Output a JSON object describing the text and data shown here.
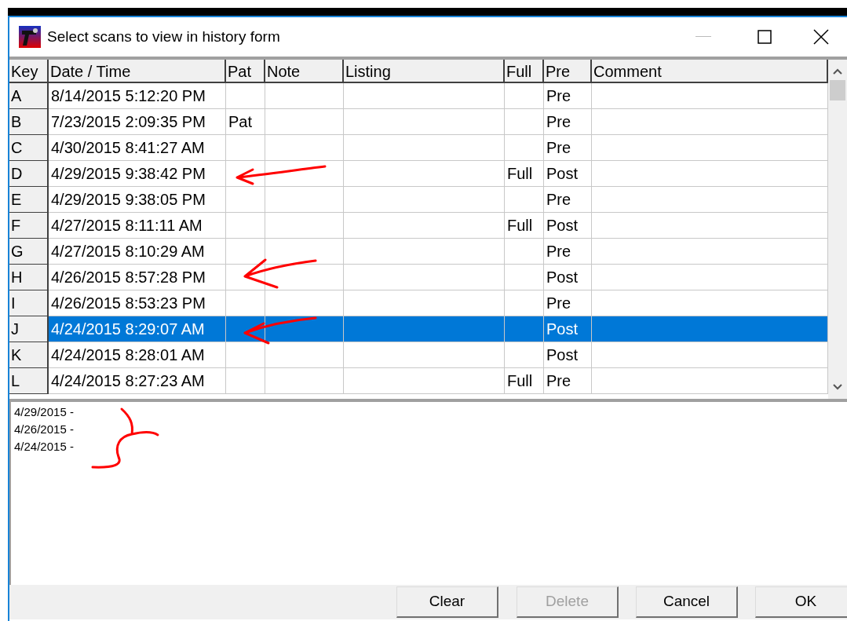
{
  "window": {
    "title": "Select scans to view in history form"
  },
  "table": {
    "columns": [
      "Key",
      "Date / Time",
      "Pat",
      "Note",
      "Listing",
      "Full",
      "Pre",
      "Comment"
    ],
    "rows": [
      {
        "key": "A",
        "datetime": "8/14/2015 5:12:20 PM",
        "pat": "",
        "full": "",
        "pre": "Pre",
        "selected": false
      },
      {
        "key": "B",
        "datetime": "7/23/2015 2:09:35 PM",
        "pat": "Pat",
        "full": "",
        "pre": "Pre",
        "selected": false
      },
      {
        "key": "C",
        "datetime": "4/30/2015 8:41:27 AM",
        "pat": "",
        "full": "",
        "pre": "Pre",
        "selected": false
      },
      {
        "key": "D",
        "datetime": "4/29/2015 9:38:42 PM",
        "pat": "",
        "full": "Full",
        "pre": "Post",
        "selected": false
      },
      {
        "key": "E",
        "datetime": "4/29/2015 9:38:05 PM",
        "pat": "",
        "full": "",
        "pre": "Pre",
        "selected": false
      },
      {
        "key": "F",
        "datetime": "4/27/2015 8:11:11 AM",
        "pat": "",
        "full": "Full",
        "pre": "Post",
        "selected": false
      },
      {
        "key": "G",
        "datetime": "4/27/2015 8:10:29 AM",
        "pat": "",
        "full": "",
        "pre": "Pre",
        "selected": false
      },
      {
        "key": "H",
        "datetime": "4/26/2015 8:57:28 PM",
        "pat": "",
        "full": "",
        "pre": "Post",
        "selected": false
      },
      {
        "key": "I",
        "datetime": "4/26/2015 8:53:23 PM",
        "pat": "",
        "full": "",
        "pre": "Pre",
        "selected": false
      },
      {
        "key": "J",
        "datetime": "4/24/2015 8:29:07 AM",
        "pat": "",
        "full": "",
        "pre": "Post",
        "selected": true
      },
      {
        "key": "K",
        "datetime": "4/24/2015 8:28:01 AM",
        "pat": "",
        "full": "",
        "pre": "Post",
        "selected": false
      },
      {
        "key": "L",
        "datetime": "4/24/2015 8:27:23 AM",
        "pat": "",
        "full": "Full",
        "pre": "Pre",
        "selected": false
      }
    ]
  },
  "memo": {
    "lines": [
      "4/29/2015 -",
      "4/26/2015 -",
      "4/24/2015 -"
    ]
  },
  "buttons": [
    {
      "label": "Clear",
      "disabled": false
    },
    {
      "label": "Delete",
      "disabled": true
    },
    {
      "label": "Cancel",
      "disabled": false
    },
    {
      "label": "OK",
      "disabled": false
    }
  ]
}
